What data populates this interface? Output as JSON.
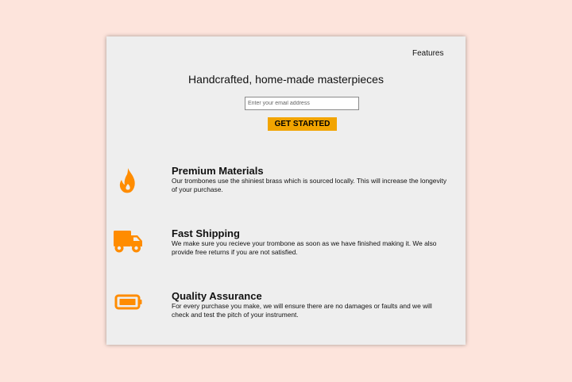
{
  "nav": {
    "features_label": "Features"
  },
  "hero": {
    "title": "Handcrafted, home-made masterpieces",
    "email_placeholder": "Enter your email address",
    "cta_label": "GET STARTED"
  },
  "features": [
    {
      "icon": "flame-icon",
      "title": "Premium Materials",
      "description": "Our trombones use the shiniest brass which is sourced locally. This will increase the longevity of your purchase."
    },
    {
      "icon": "truck-icon",
      "title": "Fast Shipping",
      "description": "We make sure you recieve your trombone as soon as we have finished making it. We also provide free returns if you are not satisfied."
    },
    {
      "icon": "battery-icon",
      "title": "Quality Assurance",
      "description": "For every purchase you make, we will ensure there are no damages or faults and we will check and test the pitch of your instrument."
    }
  ],
  "colors": {
    "page_background": "#fde4dc",
    "panel_background": "#eeeeee",
    "accent": "#f2a400",
    "icon_orange": "#ff8c00"
  }
}
